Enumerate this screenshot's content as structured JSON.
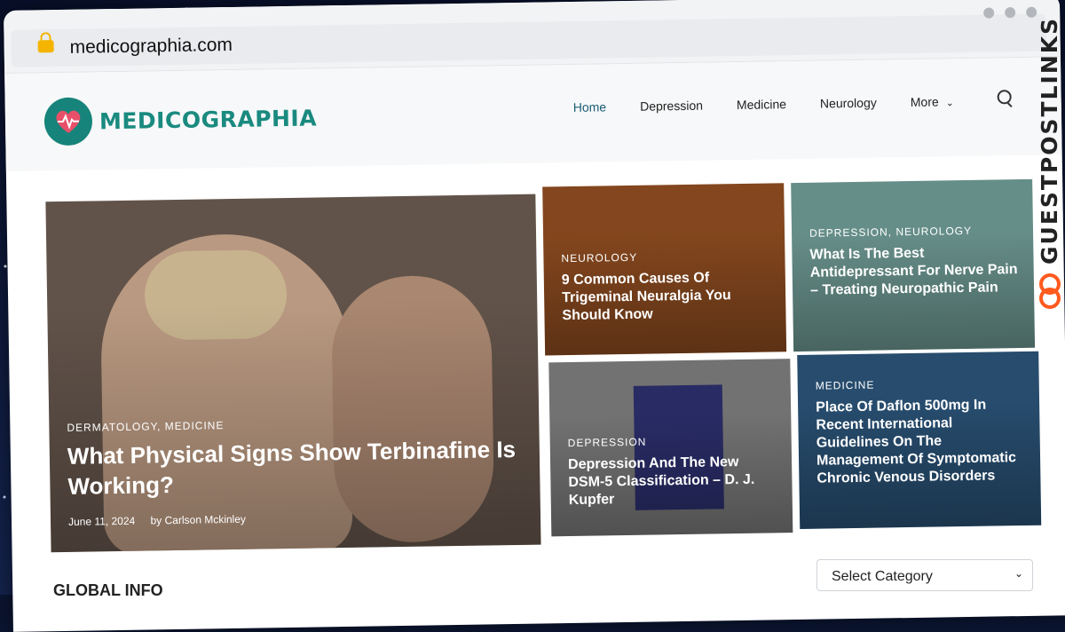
{
  "browser": {
    "url": "medicographia.com"
  },
  "site": {
    "logo_text": "MEDICOGRAPHIA"
  },
  "nav": {
    "items": [
      "Home",
      "Depression",
      "Medicine",
      "Neurology"
    ],
    "more": "More"
  },
  "featured": {
    "big": {
      "category": "DERMATOLOGY, MEDICINE",
      "title": "What Physical Signs Show Terbinafine Is Working?",
      "date": "June 11, 2024",
      "author": "by Carlson Mckinley"
    },
    "trigeminal": {
      "category": "NEUROLOGY",
      "title": "9 Common Causes Of Trigeminal Neuralgia You Should Know"
    },
    "antidepressant": {
      "category": "DEPRESSION, NEUROLOGY",
      "title": "What Is The Best Antidepressant For Nerve Pain – Treating Neuropathic Pain"
    },
    "dsm": {
      "category": "DEPRESSION",
      "title": "Depression And The New DSM-5 Classification – D. J. Kupfer"
    },
    "daflon": {
      "category": "MEDICINE",
      "title": "Place Of Daflon 500mg In Recent International Guidelines On The Management Of Symptomatic Chronic Venous Disorders"
    }
  },
  "sidebar": {
    "select_label": "Select Category"
  },
  "section": {
    "heading": "GLOBAL INFO"
  },
  "watermark": {
    "text": "GUESTPOSTLINKS"
  },
  "colors": {
    "brand": "#1a8a7f",
    "accent": "#ff5a1f"
  }
}
